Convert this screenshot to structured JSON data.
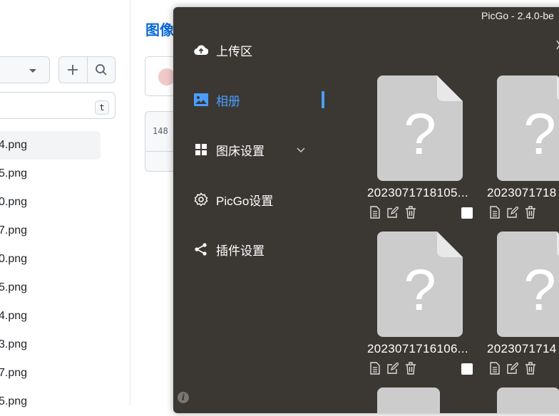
{
  "background": {
    "page_title": "图像",
    "kbd_hint": "t",
    "code_line": "148",
    "files": [
      "4.png",
      "5.png",
      "0.png",
      "7.png",
      "0.png",
      "5.png",
      "4.png",
      "3.png",
      "7.png",
      "5.png"
    ]
  },
  "picgo": {
    "title": "PicGo - 2.4.0-be",
    "close_glyph": "",
    "menu": [
      {
        "label": "上传区",
        "icon": "cloud-upload-icon"
      },
      {
        "label": "相册",
        "icon": "image-icon",
        "active": true
      },
      {
        "label": "图床设置",
        "icon": "grid-icon"
      },
      {
        "label": "PicGo设置",
        "icon": "gear-icon"
      },
      {
        "label": "插件设置",
        "icon": "share-icon"
      }
    ],
    "gallery": [
      {
        "name": "2023071718105..."
      },
      {
        "name": "2023071718"
      },
      {
        "name": "2023071716106..."
      },
      {
        "name": "2023071714"
      }
    ],
    "colors": {
      "window_bg": "#3b3834",
      "accent": "#4a9eff",
      "thumb": "#cccccc"
    }
  }
}
